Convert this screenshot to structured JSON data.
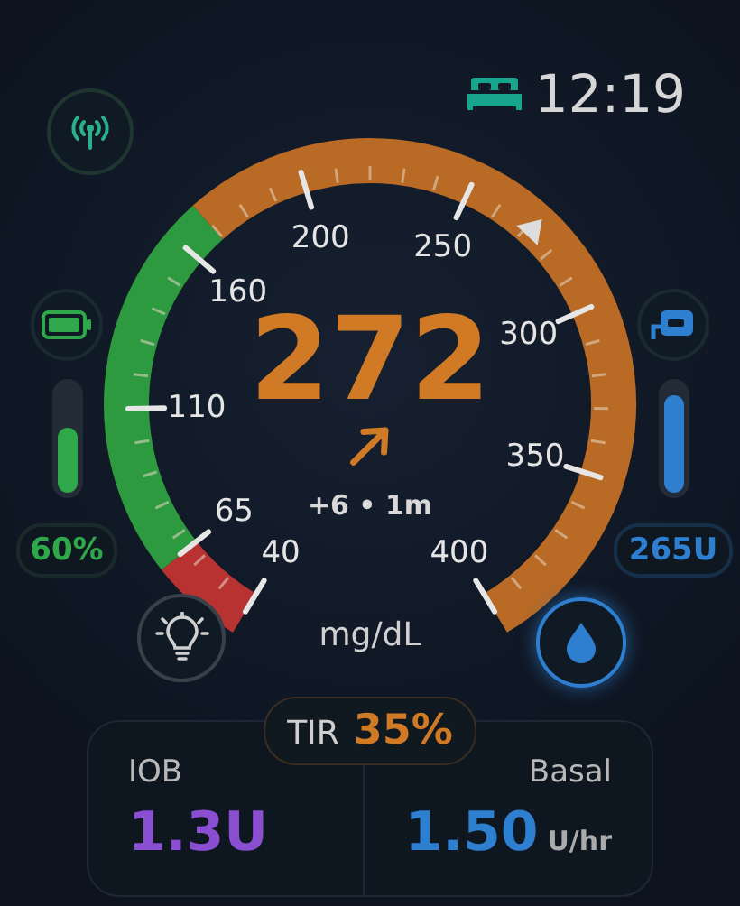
{
  "status": {
    "time": "12:19",
    "sleep_mode": true
  },
  "pump_battery": {
    "level": 0.6,
    "reading": "60%"
  },
  "reservoir": {
    "level": 0.9,
    "reading": "265U"
  },
  "gauge": {
    "zones": [
      {
        "color": "#b83232"
      },
      {
        "color": "#2e9a3f"
      },
      {
        "color": "#b96a24"
      }
    ],
    "ticks": [
      {
        "label": "40"
      },
      {
        "label": "65"
      },
      {
        "label": "110"
      },
      {
        "label": "160"
      },
      {
        "label": "200"
      },
      {
        "label": "250"
      },
      {
        "label": "300"
      },
      {
        "label": "350"
      },
      {
        "label": "400"
      }
    ],
    "reading": "272",
    "trend": "+6 • 1m",
    "unit": "mg/dL"
  },
  "tir": {
    "label": "TIR",
    "value": "35%"
  },
  "iob": {
    "label": "IOB",
    "value": "1.3U"
  },
  "basal": {
    "label": "Basal",
    "value": "1.50",
    "unit": "U/hr"
  }
}
